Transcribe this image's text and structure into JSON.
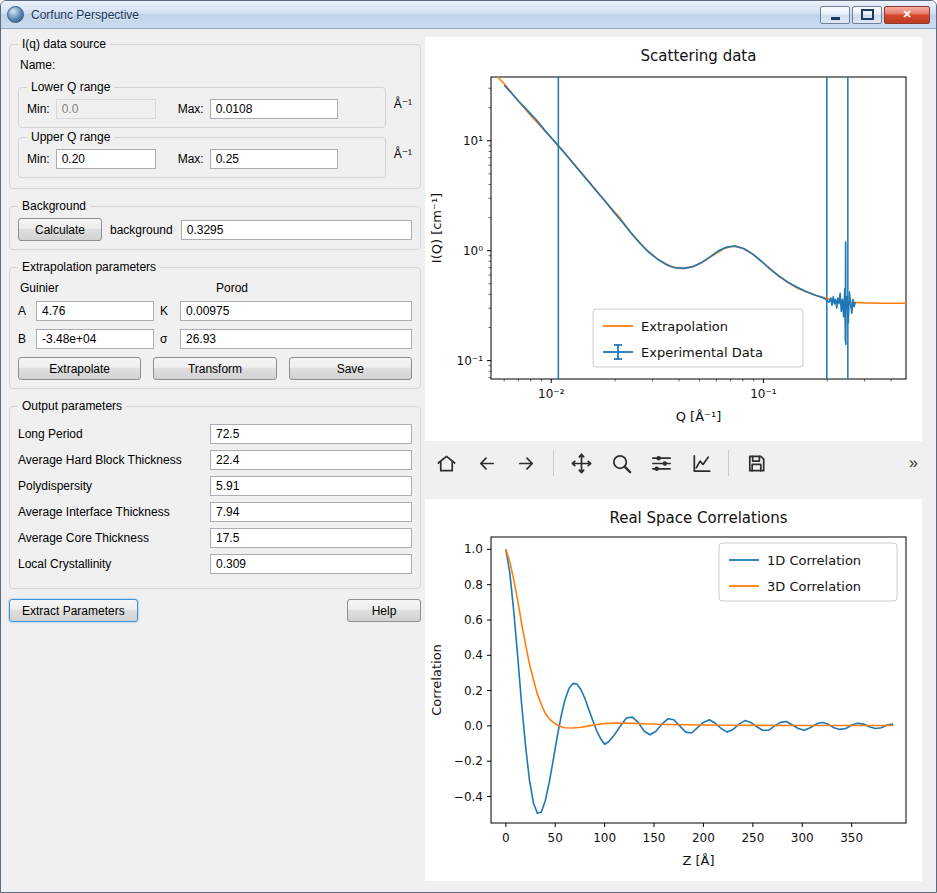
{
  "window": {
    "title": "Corfunc Perspective",
    "close_glyph": "✕"
  },
  "left": {
    "data_source": {
      "title": "I(q) data source",
      "name_label": "Name:",
      "lower_q": {
        "title": "Lower Q range",
        "min_label": "Min:",
        "min_value": "0.0",
        "max_label": "Max:",
        "max_value": "0.0108",
        "unit": "Å⁻¹"
      },
      "upper_q": {
        "title": "Upper Q range",
        "min_label": "Min:",
        "min_value": "0.20",
        "max_label": "Max:",
        "max_value": "0.25",
        "unit": "Å⁻¹"
      }
    },
    "background": {
      "title": "Background",
      "calculate": "Calculate",
      "label": "background",
      "value": "0.3295"
    },
    "extrapolation": {
      "title": "Extrapolation parameters",
      "guinier": "Guinier",
      "porod": "Porod",
      "a_label": "A",
      "a_value": "4.76",
      "k_label": "K",
      "k_value": "0.00975",
      "b_label": "B",
      "b_value": "-3.48e+04",
      "sigma_label": "σ",
      "sigma_value": "26.93",
      "extrapolate": "Extrapolate",
      "transform": "Transform",
      "save": "Save"
    },
    "output": {
      "title": "Output parameters",
      "rows": [
        {
          "label": "Long Period",
          "value": "72.5"
        },
        {
          "label": "Average Hard Block Thickness",
          "value": "22.4"
        },
        {
          "label": "Polydispersity",
          "value": "5.91"
        },
        {
          "label": "Average Interface Thickness",
          "value": "7.94"
        },
        {
          "label": "Average Core Thickness",
          "value": "17.5"
        },
        {
          "label": "Local Crystallinity",
          "value": "0.309"
        }
      ]
    },
    "extract": "Extract Parameters",
    "help": "Help"
  },
  "toolbar": {
    "overflow": "»"
  },
  "chart_data": [
    {
      "type": "line",
      "title": "Scattering data",
      "xlabel": "Q [Å⁻¹]",
      "ylabel": "I(Q) [cm⁻¹]",
      "xscale": "log",
      "yscale": "log",
      "xlim": [
        0.0052,
        0.47
      ],
      "ylim": [
        0.068,
        38
      ],
      "xticks": [
        0.01,
        0.1
      ],
      "xtick_labels": [
        "10⁻²",
        "10⁻¹"
      ],
      "yticks": [
        0.1,
        1,
        10
      ],
      "ytick_labels": [
        "10⁻¹",
        "10⁰",
        "10¹"
      ],
      "grid": false,
      "legend_loc": "lower center",
      "vlines": {
        "color": "#1f77b4",
        "x": [
          0.0108,
          0.199,
          0.25
        ]
      },
      "series": [
        {
          "name": "Extrapolation",
          "color": "#ff7f0e",
          "legend_sample": "line",
          "x": [
            0.0052,
            0.006,
            0.007,
            0.008,
            0.009,
            0.01,
            0.0112,
            0.0125,
            0.014,
            0.016,
            0.018,
            0.021,
            0.024,
            0.028,
            0.032,
            0.037,
            0.042,
            0.047,
            0.052,
            0.058,
            0.065,
            0.072,
            0.08,
            0.089,
            0.098,
            0.108,
            0.119,
            0.131,
            0.145,
            0.16,
            0.177,
            0.196,
            0.22,
            0.25,
            0.3,
            0.36,
            0.47
          ],
          "y": [
            44,
            33,
            23,
            17,
            13.3,
            10.6,
            8.3,
            6.5,
            5.0,
            3.7,
            2.8,
            2.0,
            1.42,
            1.02,
            0.83,
            0.71,
            0.69,
            0.72,
            0.79,
            0.91,
            1.04,
            1.1,
            1.05,
            0.93,
            0.8,
            0.68,
            0.58,
            0.51,
            0.455,
            0.42,
            0.39,
            0.37,
            0.35,
            0.34,
            0.335,
            0.333,
            0.333
          ]
        },
        {
          "name": "Experimental Data",
          "color": "#1f77b4",
          "legend_sample": "errorbar",
          "x": [
            0.006,
            0.0065,
            0.007,
            0.0077,
            0.0085,
            0.0093,
            0.0102,
            0.0112,
            0.0123,
            0.0135,
            0.0149,
            0.0163,
            0.018,
            0.0197,
            0.0217,
            0.0238,
            0.0262,
            0.0288,
            0.0316,
            0.0347,
            0.0382,
            0.0419,
            0.0461,
            0.0506,
            0.0556,
            0.0611,
            0.0672,
            0.0738,
            0.0811,
            0.0891,
            0.0979,
            0.1076,
            0.1182,
            0.1299,
            0.1427,
            0.1568,
            0.1723,
            0.1893,
            0.198,
            0.204,
            0.208,
            0.2106,
            0.2133,
            0.216,
            0.2187,
            0.2215,
            0.2243,
            0.2271,
            0.23,
            0.2329,
            0.2359,
            0.2389,
            0.2419,
            0.2435,
            0.244,
            0.2445,
            0.245,
            0.2481,
            0.2512,
            0.2544,
            0.2576,
            0.2609,
            0.2642,
            0.2676,
            0.271
          ],
          "y": [
            32,
            27,
            23,
            19,
            15.5,
            12.5,
            10.2,
            8.3,
            6.7,
            5.4,
            4.3,
            3.5,
            2.8,
            2.25,
            1.8,
            1.45,
            1.17,
            0.97,
            0.84,
            0.75,
            0.7,
            0.69,
            0.71,
            0.77,
            0.87,
            0.99,
            1.08,
            1.1,
            1.04,
            0.93,
            0.8,
            0.68,
            0.59,
            0.52,
            0.47,
            0.43,
            0.4,
            0.375,
            0.36,
            0.34,
            0.37,
            0.32,
            0.38,
            0.33,
            0.36,
            0.3,
            0.37,
            0.33,
            0.41,
            0.28,
            0.36,
            0.25,
            0.45,
            0.15,
            1.2,
            0.14,
            0.3,
            0.38,
            0.22,
            0.42,
            0.33,
            0.27,
            0.36,
            0.31,
            0.34
          ]
        }
      ]
    },
    {
      "type": "line",
      "title": "Real Space Correlations",
      "xlabel": "Z [Å]",
      "ylabel": "Correlation",
      "xscale": "linear",
      "yscale": "linear",
      "xlim": [
        -15,
        405
      ],
      "ylim": [
        -0.55,
        1.07
      ],
      "xticks": [
        0,
        50,
        100,
        150,
        200,
        250,
        300,
        350
      ],
      "xtick_labels": [
        "0",
        "50",
        "100",
        "150",
        "200",
        "250",
        "300",
        "350"
      ],
      "yticks": [
        -0.4,
        -0.2,
        0.0,
        0.2,
        0.4,
        0.6,
        0.8,
        1.0
      ],
      "ytick_labels": [
        "−0.4",
        "−0.2",
        "0.0",
        "0.2",
        "0.4",
        "0.6",
        "0.8",
        "1.0"
      ],
      "grid": false,
      "legend_loc": "upper right",
      "series": [
        {
          "name": "1D Correlation",
          "color": "#1f77b4",
          "legend_sample": "line",
          "x": [
            0,
            4,
            8,
            12,
            16,
            20,
            24,
            28,
            32,
            36,
            40,
            44,
            48,
            52,
            56,
            60,
            64,
            68,
            72,
            76,
            80,
            84,
            88,
            92,
            96,
            100,
            104,
            110,
            116,
            122,
            128,
            134,
            140,
            146,
            152,
            158,
            164,
            170,
            176,
            182,
            188,
            194,
            200,
            206,
            212,
            218,
            224,
            230,
            236,
            242,
            248,
            254,
            260,
            266,
            272,
            278,
            284,
            290,
            296,
            302,
            308,
            314,
            320,
            326,
            332,
            338,
            344,
            350,
            356,
            362,
            368,
            374,
            380,
            386,
            392
          ],
          "y": [
            1.0,
            0.868,
            0.653,
            0.393,
            0.126,
            -0.116,
            -0.309,
            -0.438,
            -0.495,
            -0.487,
            -0.422,
            -0.318,
            -0.191,
            -0.061,
            0.057,
            0.151,
            0.213,
            0.241,
            0.237,
            0.206,
            0.155,
            0.093,
            0.03,
            -0.028,
            -0.073,
            -0.104,
            -0.09,
            -0.05,
            0.0,
            0.045,
            0.05,
            0.02,
            -0.03,
            -0.05,
            -0.03,
            0.01,
            0.04,
            0.035,
            0.0,
            -0.035,
            -0.04,
            -0.01,
            0.02,
            0.035,
            0.015,
            -0.015,
            -0.035,
            -0.02,
            0.01,
            0.03,
            0.02,
            -0.005,
            -0.025,
            -0.025,
            0.0,
            0.02,
            0.025,
            0.005,
            -0.015,
            -0.025,
            -0.01,
            0.01,
            0.02,
            0.01,
            -0.01,
            -0.02,
            -0.015,
            0.005,
            0.015,
            0.01,
            -0.005,
            -0.015,
            -0.01,
            0.005,
            0.01
          ]
        },
        {
          "name": "3D Correlation",
          "color": "#ff7f0e",
          "legend_sample": "line",
          "x": [
            0,
            4,
            8,
            12,
            16,
            20,
            24,
            28,
            32,
            36,
            40,
            44,
            48,
            52,
            56,
            60,
            68,
            76,
            84,
            92,
            100,
            110,
            120,
            130,
            140,
            160,
            180,
            220,
            260,
            300,
            350,
            392
          ],
          "y": [
            1.0,
            0.93,
            0.83,
            0.71,
            0.58,
            0.46,
            0.35,
            0.26,
            0.18,
            0.12,
            0.07,
            0.04,
            0.02,
            0.005,
            -0.005,
            -0.01,
            -0.012,
            -0.008,
            0.0,
            0.008,
            0.013,
            0.016,
            0.016,
            0.014,
            0.012,
            0.008,
            0.006,
            0.004,
            0.003,
            0.002,
            0.002,
            0.002
          ]
        }
      ]
    }
  ]
}
